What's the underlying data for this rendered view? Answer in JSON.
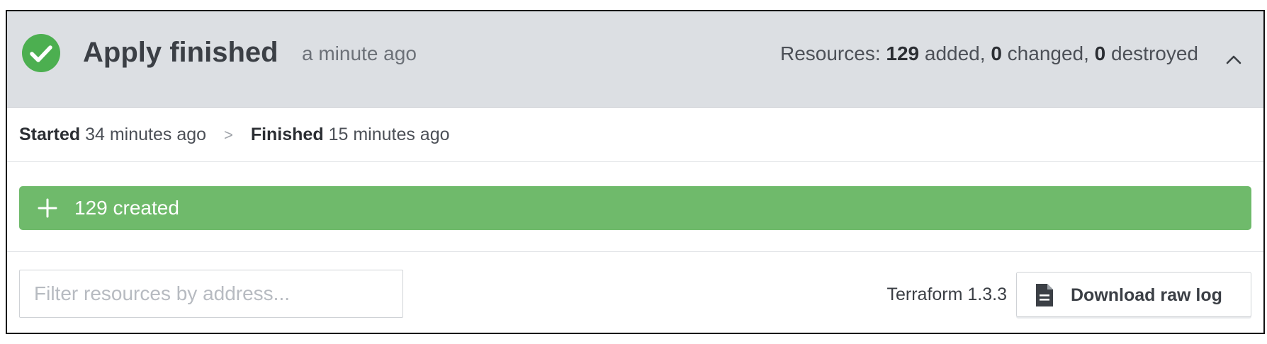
{
  "header": {
    "title": "Apply finished",
    "title_ago": "a minute ago",
    "resources_prefix": "Resources:",
    "added_count": "129",
    "added_label": "added,",
    "changed_count": "0",
    "changed_label": "changed,",
    "destroyed_count": "0",
    "destroyed_label": "destroyed",
    "status_icon": "check-circle-icon",
    "collapse_icon": "chevron-up-icon",
    "status_color": "#4caf50"
  },
  "timing": {
    "started_label": "Started",
    "started_value": "34 minutes ago",
    "separator": ">",
    "finished_label": "Finished",
    "finished_value": "15 minutes ago"
  },
  "summary": {
    "created_label": "129 created",
    "icon": "plus-icon",
    "bar_color": "#6fba6b"
  },
  "footer": {
    "filter_placeholder": "Filter resources by address...",
    "filter_value": "",
    "terraform_version": "Terraform 1.3.3",
    "download_label": "Download raw log",
    "download_icon": "file-icon"
  }
}
